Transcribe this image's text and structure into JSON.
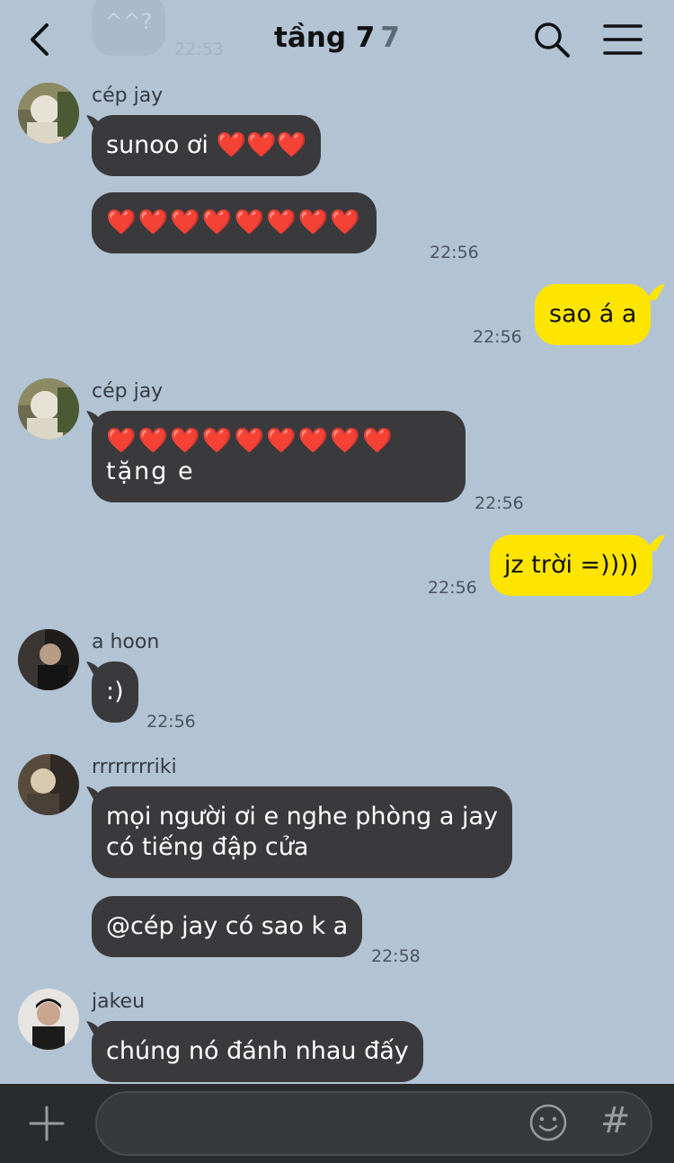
{
  "header": {
    "title": "tầng 7",
    "member_count": "7"
  },
  "previous": {
    "text": "^^?",
    "time": "22:53"
  },
  "messages": [
    {
      "sender": "cép jay",
      "lines": [
        "sunoo ơi ❤️❤️❤️",
        "❤️❤️❤️❤️❤️❤️❤️❤️"
      ],
      "time": "22:56"
    },
    {
      "self": true,
      "text": "sao á a",
      "time": "22:56"
    },
    {
      "sender": "cép jay",
      "text": "❤️❤️❤️❤️❤️❤️❤️❤️❤️\ntặng e",
      "time": "22:56"
    },
    {
      "self": true,
      "text": "jz trời =))))",
      "time": "22:56"
    },
    {
      "sender": "a hoon",
      "text": ":)",
      "time": "22:56"
    },
    {
      "sender": "rrrrrrrriki",
      "lines": [
        "mọi người ơi e nghe phòng a jay\ncó tiếng đập cửa",
        "@cép jay có sao k a"
      ],
      "time": "22:58"
    },
    {
      "sender": "jakeu",
      "text": "chúng nó đánh nhau đấy"
    }
  ],
  "composer": {
    "hash_symbol": "#"
  },
  "icons": {
    "back": "chevron-left-icon",
    "search": "search-icon",
    "menu": "menu-icon",
    "add": "plus-icon",
    "emoji": "emoji-icon",
    "hashtag": "hashtag-icon"
  },
  "colors": {
    "background": "#b2c3d4",
    "incoming_bubble": "#3a3a3c",
    "outgoing_bubble": "#fee500",
    "bottom_bar": "#2a2b2d"
  }
}
